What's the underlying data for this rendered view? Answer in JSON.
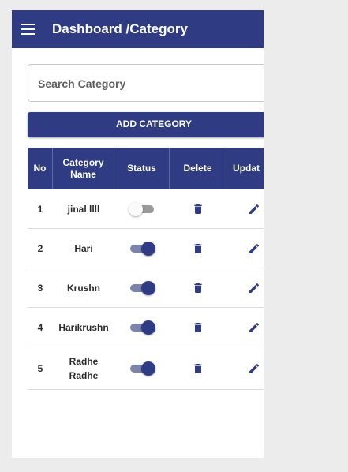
{
  "appbar": {
    "title": "Dashboard /Category"
  },
  "search": {
    "placeholder": "Search Category",
    "value": ""
  },
  "add_button": {
    "label": "ADD CATEGORY"
  },
  "table": {
    "headers": {
      "no": "No",
      "name": "Category Name",
      "status": "Status",
      "delete": "Delete",
      "update": "Updat"
    },
    "rows": [
      {
        "no": "1",
        "name": "jinal llll",
        "status_on": false
      },
      {
        "no": "2",
        "name": "Hari",
        "status_on": true
      },
      {
        "no": "3",
        "name": "Krushn",
        "status_on": true
      },
      {
        "no": "4",
        "name": "Harikrushn",
        "status_on": true
      },
      {
        "no": "5",
        "name": "Radhe Radhe",
        "status_on": true
      }
    ]
  },
  "colors": {
    "primary": "#2f3b82",
    "background": "#ececec",
    "toggle_track_on": "#7b84ad"
  },
  "icons": {
    "menu": "menu-icon",
    "delete": "trash-icon",
    "update": "pencil-icon"
  }
}
